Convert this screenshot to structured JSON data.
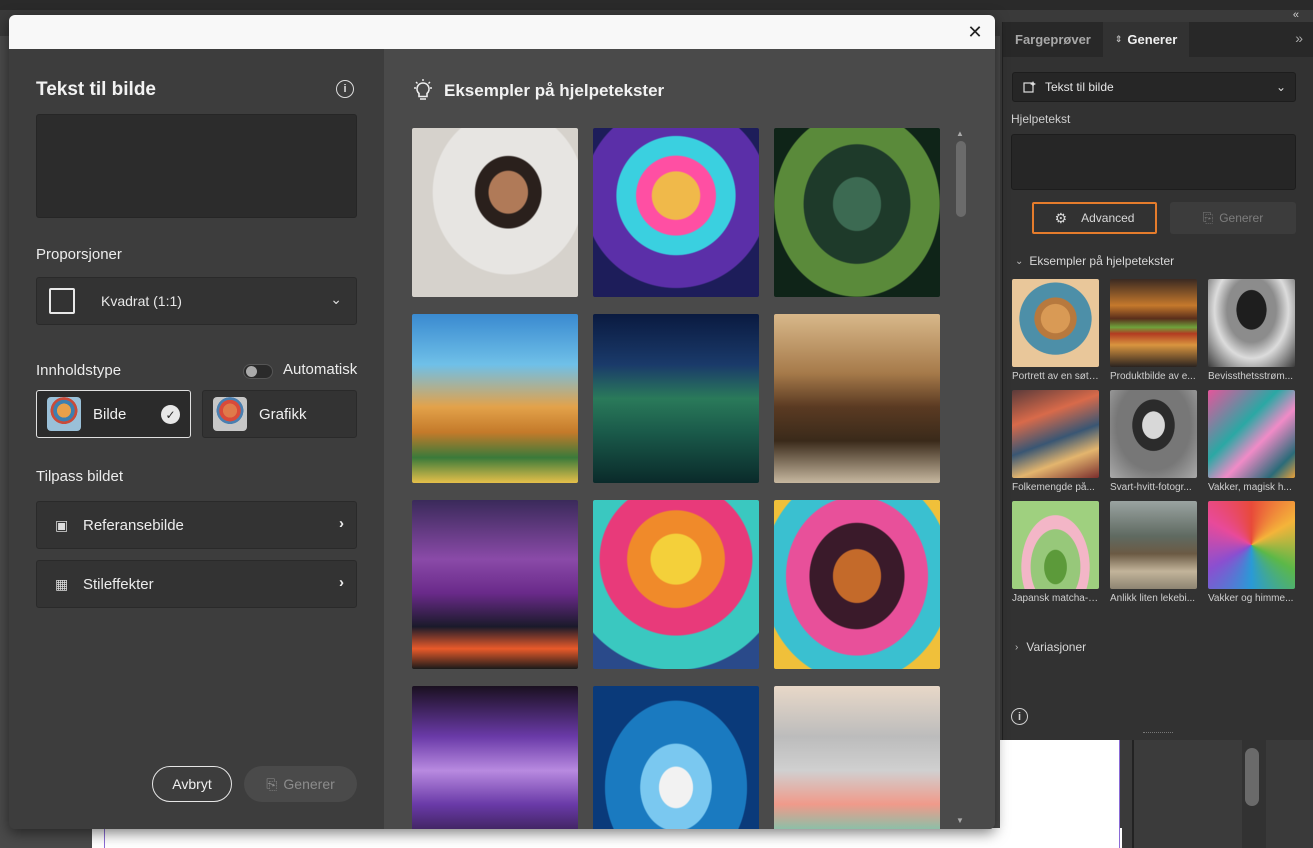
{
  "app": {
    "tab_hint": "n",
    "collapse_glyph": "«"
  },
  "panel": {
    "tabs": [
      {
        "label": "Fargeprøver",
        "active": false
      },
      {
        "label": "Generer",
        "active": true,
        "sort_glyph": "⇕"
      }
    ],
    "more_glyph": "»",
    "mode_select": {
      "value": "Tekst til bilde"
    },
    "prompt_label": "Hjelpetekst",
    "advanced_label": "Advanced",
    "generate_label": "Generer",
    "examples_heading": "Eksempler på hjelpetekster",
    "examples": [
      {
        "caption": "Portrett av en søt,...",
        "icon": "kitten-portrait"
      },
      {
        "caption": "Produktbilde av e...",
        "icon": "burger-product"
      },
      {
        "caption": "Bevissthetsstrøm...",
        "icon": "tree-surreal"
      },
      {
        "caption": "Folkemengde på...",
        "icon": "city-crowd"
      },
      {
        "caption": "Svart-hvitt-fotogr...",
        "icon": "bw-portrait"
      },
      {
        "caption": "Vakker, magisk h...",
        "icon": "flamingo-garden"
      },
      {
        "caption": "Japansk matcha-s...",
        "icon": "matcha-scene"
      },
      {
        "caption": "Anlikk liten lekebi...",
        "icon": "toy-car"
      },
      {
        "caption": "Vakker og himme...",
        "icon": "origami-star"
      }
    ],
    "variations_label": "Variasjoner",
    "info_glyph": "i"
  },
  "modal": {
    "title": "Tekst til bilde",
    "info_glyph": "i",
    "prompt_value": "",
    "proportions_label": "Proporsjoner",
    "proportions_value": "Kvadrat (1:1)",
    "content_type_label": "Innholdstype",
    "auto_label": "Automatisk",
    "auto_on": false,
    "type_photo_label": "Bilde",
    "type_graphic_label": "Grafikk",
    "customize_label": "Tilpass bildet",
    "reference_label": "Referansebilde",
    "style_label": "Stileffekter",
    "cancel_label": "Avbryt",
    "generate_label": "Generer",
    "examples_heading": "Eksempler på hjelpetekster",
    "example_images": [
      {
        "name": "woman-profile-portrait"
      },
      {
        "name": "neon-dog-sunglasses"
      },
      {
        "name": "jungle-statue"
      },
      {
        "name": "giraffes-city"
      },
      {
        "name": "underwater-castle"
      },
      {
        "name": "steampunk-ship"
      },
      {
        "name": "purple-sports-car"
      },
      {
        "name": "horses-sunset"
      },
      {
        "name": "afro-woman-portrait"
      },
      {
        "name": "happy-birthday-balloons"
      },
      {
        "name": "can-water-splash"
      },
      {
        "name": "laptop-desk"
      }
    ]
  },
  "colors": {
    "accent_orange": "#e57c2c",
    "panel_bg": "#323232",
    "modal_bg": "#3d3d3d"
  }
}
